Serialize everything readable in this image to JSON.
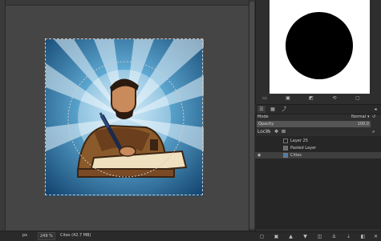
{
  "status": {
    "unit": "px",
    "zoom": "249 %",
    "info": "Cites (42.7 MB)"
  },
  "layers_panel": {
    "mode_label": "Mode",
    "mode_value": "Normal",
    "opacity_label": "Opacity",
    "opacity_value": "100.0",
    "lock_label": "Lock:",
    "layers": [
      {
        "name": "Layer 25",
        "visible": false,
        "active": false
      },
      {
        "name": "Pasted Layer",
        "visible": false,
        "active": false
      },
      {
        "name": "Cities",
        "visible": true,
        "active": true
      }
    ]
  },
  "icons": {
    "dock_tabs": [
      "layers-icon",
      "channels-icon",
      "paths-icon"
    ],
    "bottom_buttons": [
      "new-layer-group-icon",
      "new-layer-icon",
      "raise-layer-icon",
      "lower-layer-icon",
      "duplicate-layer-icon",
      "anchor-layer-icon",
      "merge-down-icon",
      "mask-icon",
      "delete-layer-icon"
    ]
  },
  "colors": {
    "sky_dark": "#0f4a78",
    "sky_light": "#6fb3d8",
    "background_canvas": "#454545"
  }
}
